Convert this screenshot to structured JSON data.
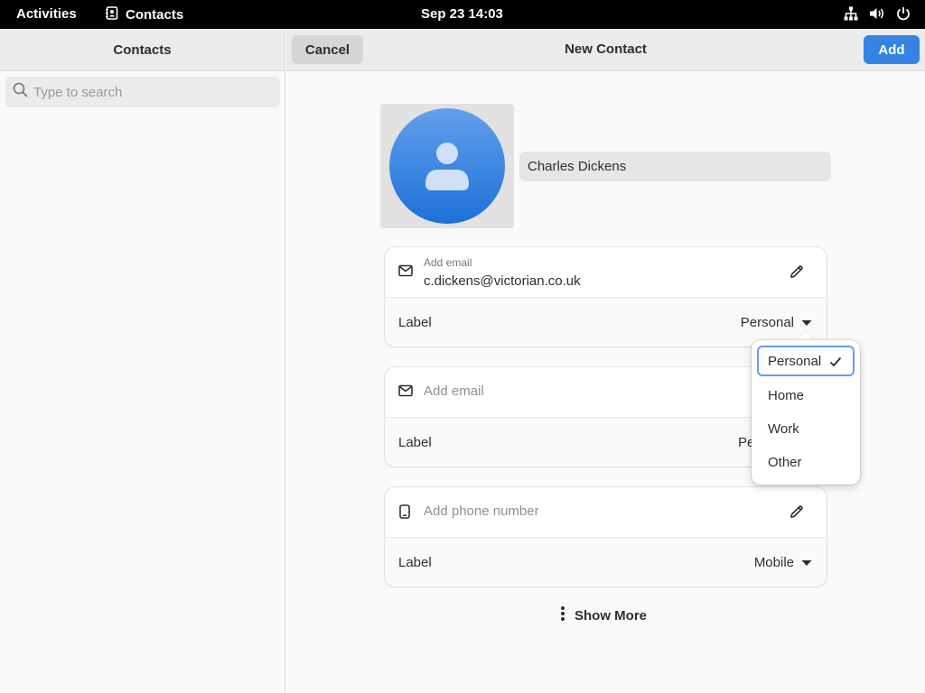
{
  "topbar": {
    "activities": "Activities",
    "app_name": "Contacts",
    "clock": "Sep 23  14:03"
  },
  "sidebar": {
    "title": "Contacts",
    "search_placeholder": "Type to search"
  },
  "header": {
    "cancel_label": "Cancel",
    "title": "New Contact",
    "add_label": "Add"
  },
  "contact": {
    "name": "Charles Dickens"
  },
  "email1": {
    "small_label": "Add email",
    "value": "c.dickens@victorian.co.uk",
    "label_text": "Label",
    "type": "Personal"
  },
  "email2": {
    "placeholder": "Add email",
    "label_text": "Label",
    "type_partial": "Pe"
  },
  "phone": {
    "placeholder": "Add phone number",
    "label_text": "Label",
    "type": "Mobile"
  },
  "popover": {
    "items": [
      "Personal",
      "Home",
      "Work",
      "Other"
    ],
    "selected": "Personal"
  },
  "show_more_label": "Show More",
  "colors": {
    "accent": "#3584e4",
    "focus": "#62a0ea",
    "avatar_top": "#62a0ea",
    "avatar_bottom": "#1c71d8"
  }
}
